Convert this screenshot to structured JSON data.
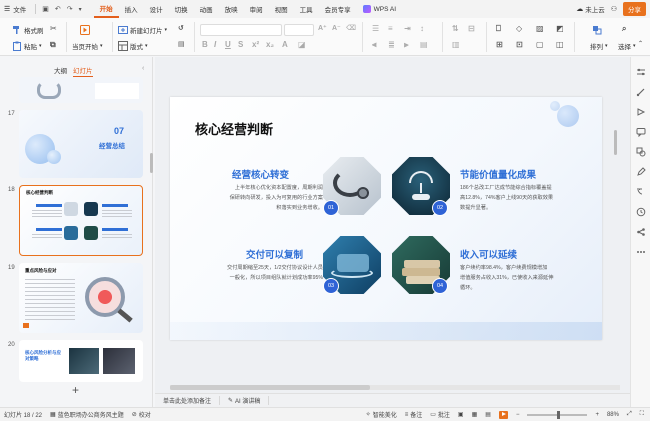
{
  "menu": {
    "file": "文件",
    "tabs": [
      "开始",
      "插入",
      "设计",
      "切换",
      "动画",
      "放映",
      "审阅",
      "视图",
      "工具",
      "会员专享"
    ],
    "active_tab": "开始",
    "wps_ai": "WPS AI",
    "cloud": "未上云",
    "share": "分享"
  },
  "ribbon": {
    "format_painter": "格式刷",
    "paste": "粘贴",
    "current_start": "当页开始",
    "new_slide": "新建幻灯片",
    "layout": "版式",
    "arrange": "排列",
    "select": "选择"
  },
  "left_panel": {
    "tab_outline": "大纲",
    "tab_slides": "幻灯片",
    "slides": [
      {
        "num": "17",
        "number_text": "07",
        "title": "经营总结"
      },
      {
        "num": "18",
        "title": "核心经营判断"
      },
      {
        "num": "19",
        "title": "重点风险与应对"
      },
      {
        "num": "20",
        "title": "核心风险分析与应对策略"
      }
    ]
  },
  "slide": {
    "title": "核心经营判断",
    "items": [
      {
        "head": "经营核心转变",
        "body_lines": [
          "上半年核心优化资本配置度，周期利润",
          "保研转向研发，投入为可复用的行业方案",
          "积落实到业务增收。"
        ],
        "badge": "01"
      },
      {
        "head": "节能价值量化成果",
        "body_lines": [
          "186个总改工厂达成节能综合指标覆盖提",
          "高12.8%，74%客户上线90天的获取效果",
          "数提升显著。"
        ],
        "badge": "02"
      },
      {
        "head": "交付可以复制",
        "body_lines": [
          "交付周期缩至25天，1/2交付协议设计人员",
          "一般化，所以项目组队就计划成功率95%"
        ],
        "badge": "03"
      },
      {
        "head": "收入可以延续",
        "body_lines": [
          "客户续约率98.4%，客户续费规模增加",
          "增值服务占收入31%，已使收入来源延伸",
          "循环。"
        ],
        "badge": "04"
      }
    ]
  },
  "notes_bar": {
    "placeholder": "单击此处添加备注",
    "ai": "AI 演讲稿"
  },
  "status": {
    "slide_counter": "幻灯片 18 / 22",
    "theme": "蓝色职场办公商务风主题",
    "proofing": "校对",
    "smart_beautify": "智能美化",
    "notes": "备注",
    "comments": "批注",
    "zoom": "88%"
  },
  "colors": {
    "accent": "#e8711d",
    "heading_blue": "#2f6fd6",
    "badge_blue": "#2f63d6"
  }
}
